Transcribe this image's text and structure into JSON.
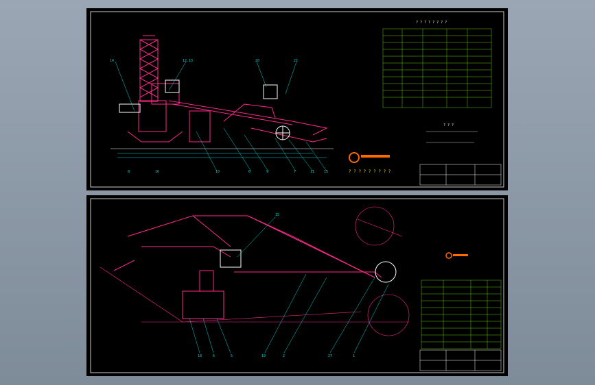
{
  "sheets": [
    {
      "id": "top",
      "table_title": "? ? ? ? ? ? ? ?",
      "notes_title": "? ? ?",
      "logo_caption": "? ? ? ? ? ? ? ? ?",
      "labels": [
        "14",
        "12.13",
        "20",
        "21",
        "8",
        "16",
        "10",
        "6",
        "9",
        "7",
        "11",
        "15"
      ]
    },
    {
      "id": "bottom",
      "labels": [
        "15",
        "18",
        "6",
        "5",
        "19",
        "2",
        "27",
        "1"
      ]
    }
  ],
  "colors": {
    "sheet_bg": "#000000",
    "frame": "#ffffff",
    "machine": "#ff2a8a",
    "dims": "#00d8d8",
    "table": "#7cfc00",
    "logo": "#ff6a00"
  }
}
